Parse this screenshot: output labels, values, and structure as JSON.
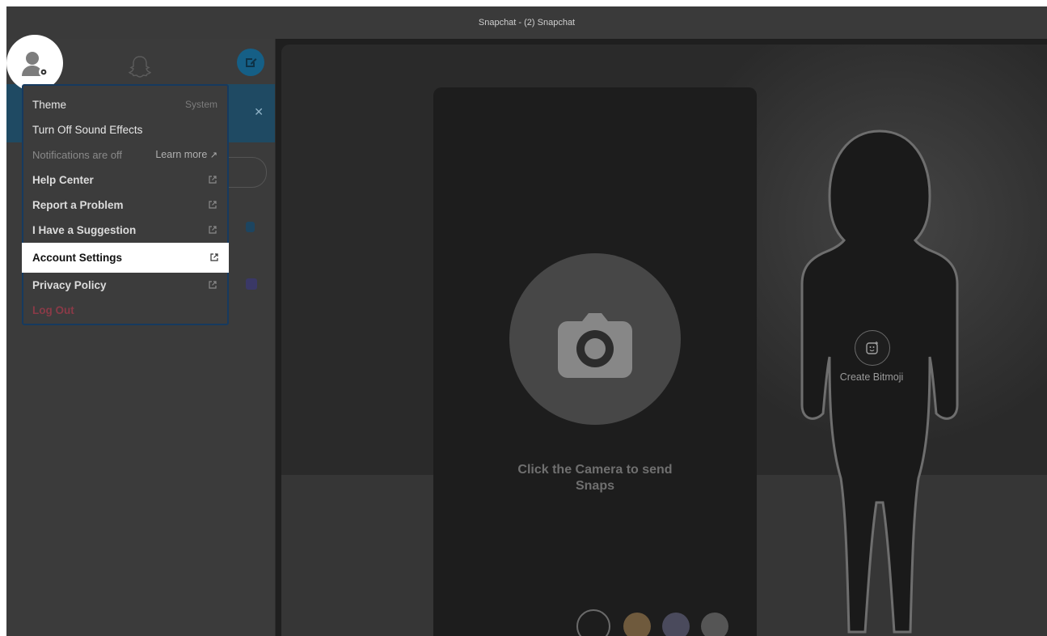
{
  "window": {
    "title": "Snapchat - (2) Snapchat"
  },
  "menu": {
    "items": [
      {
        "label": "Theme",
        "value": "System"
      },
      {
        "label": "Turn Off Sound Effects"
      },
      {
        "label": "Notifications are off",
        "link": "Learn more"
      },
      {
        "label": "Help Center"
      },
      {
        "label": "Report a Problem"
      },
      {
        "label": "I Have a Suggestion"
      },
      {
        "label": "Account Settings"
      },
      {
        "label": "Privacy Policy"
      },
      {
        "label": "Log Out"
      }
    ]
  },
  "camera": {
    "prompt": "Click the Camera to send Snaps"
  },
  "bitmoji": {
    "label": "Create Bitmoji"
  },
  "colors": {
    "accent": "#155f86",
    "menu_border": "#163a5f",
    "logout": "#8a3a47",
    "highlight": "#ffffff"
  },
  "icons": [
    "avatar-icon",
    "settings-gear-icon",
    "ghost-icon",
    "compose-icon",
    "close-icon",
    "external-link-icon",
    "camera-icon",
    "bitmoji-icon"
  ]
}
